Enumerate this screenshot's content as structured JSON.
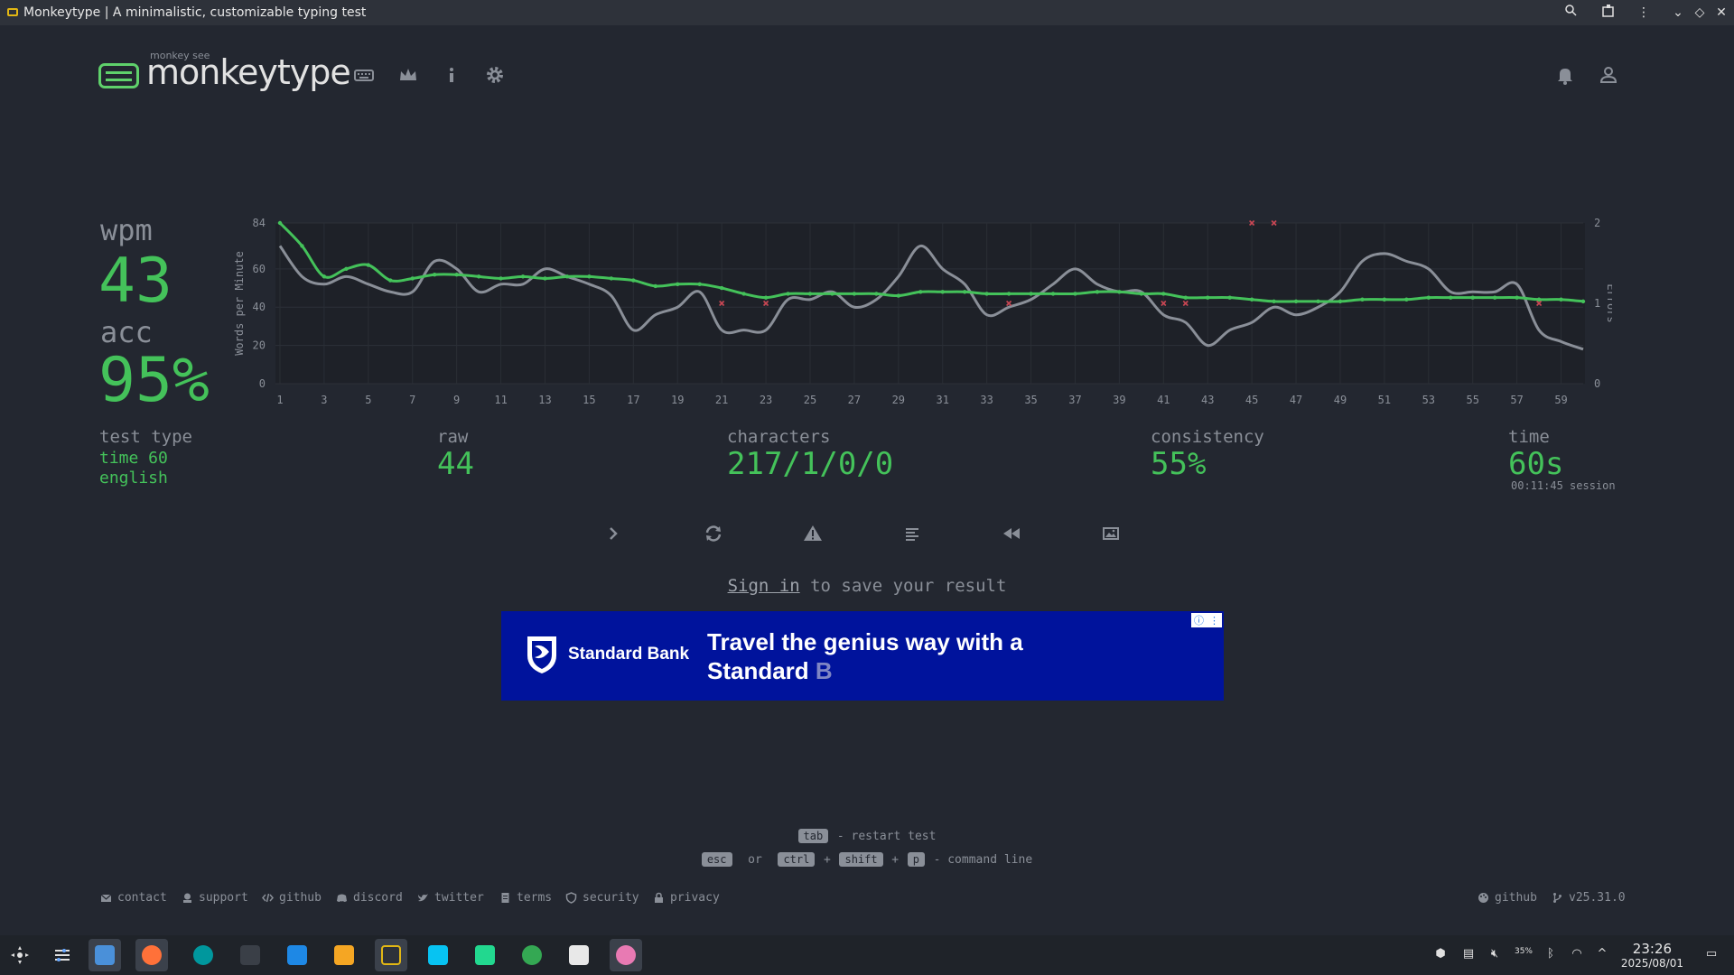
{
  "window": {
    "title": "Monkeytype | A minimalistic, customizable typing test"
  },
  "header": {
    "logo_small": "monkey see",
    "logo_text": "monkeytype",
    "nav_icons": [
      "keyboard-icon",
      "crown-icon",
      "info-icon",
      "gear-icon"
    ],
    "right_icons": [
      "bell-icon",
      "user-icon"
    ]
  },
  "stats": {
    "wpm_label": "wpm",
    "wpm_value": "43",
    "acc_label": "acc",
    "acc_value": "95%",
    "test_type_label": "test type",
    "test_type_mode": "time 60",
    "test_type_lang": "english",
    "raw_label": "raw",
    "raw_value": "44",
    "characters_label": "characters",
    "characters_value": "217/1/0/0",
    "consistency_label": "consistency",
    "consistency_value": "55%",
    "time_label": "time",
    "time_value": "60s",
    "session_value": "00:11:45 session"
  },
  "chart_data": {
    "type": "line",
    "ylabel": "Words per Minute",
    "y2label": "Errors",
    "ylim": [
      0,
      84
    ],
    "yticks": [
      0,
      20,
      40,
      60,
      84
    ],
    "y2lim": [
      0,
      2
    ],
    "y2ticks": [
      0,
      1,
      2
    ],
    "xlim": [
      1,
      60
    ],
    "xticks": [
      1,
      3,
      5,
      7,
      9,
      11,
      13,
      15,
      17,
      19,
      21,
      23,
      25,
      27,
      29,
      31,
      33,
      35,
      37,
      39,
      41,
      43,
      45,
      47,
      49,
      51,
      53,
      55,
      57,
      59
    ],
    "grid": true,
    "series": [
      {
        "name": "wpm",
        "color": "#44c25a",
        "x": [
          1,
          2,
          3,
          4,
          5,
          6,
          7,
          8,
          9,
          10,
          11,
          12,
          13,
          14,
          15,
          16,
          17,
          18,
          19,
          20,
          21,
          22,
          23,
          24,
          25,
          26,
          27,
          28,
          29,
          30,
          31,
          32,
          33,
          34,
          35,
          36,
          37,
          38,
          39,
          40,
          41,
          42,
          43,
          44,
          45,
          46,
          47,
          48,
          49,
          50,
          51,
          52,
          53,
          54,
          55,
          56,
          57,
          58,
          59,
          60
        ],
        "values": [
          84,
          72,
          56,
          60,
          62,
          54,
          55,
          57,
          57,
          56,
          55,
          56,
          55,
          56,
          56,
          55,
          54,
          51,
          52,
          52,
          50,
          47,
          45,
          47,
          47,
          47,
          47,
          47,
          46,
          48,
          48,
          48,
          47,
          47,
          47,
          47,
          47,
          48,
          48,
          47,
          47,
          45,
          45,
          45,
          44,
          43,
          43,
          43,
          43,
          44,
          44,
          44,
          45,
          45,
          45,
          45,
          45,
          44,
          44,
          43
        ]
      },
      {
        "name": "raw",
        "color": "#8a8f98",
        "x": [
          1,
          2,
          3,
          4,
          5,
          6,
          7,
          8,
          9,
          10,
          11,
          12,
          13,
          14,
          15,
          16,
          17,
          18,
          19,
          20,
          21,
          22,
          23,
          24,
          25,
          26,
          27,
          28,
          29,
          30,
          31,
          32,
          33,
          34,
          35,
          36,
          37,
          38,
          39,
          40,
          41,
          42,
          43,
          44,
          45,
          46,
          47,
          48,
          49,
          50,
          51,
          52,
          53,
          54,
          55,
          56,
          57,
          58,
          59,
          60
        ],
        "values": [
          72,
          56,
          52,
          56,
          52,
          48,
          48,
          64,
          60,
          48,
          52,
          52,
          60,
          56,
          52,
          46,
          28,
          36,
          40,
          48,
          28,
          28,
          28,
          44,
          44,
          48,
          40,
          44,
          56,
          72,
          60,
          52,
          36,
          40,
          44,
          52,
          60,
          52,
          48,
          48,
          36,
          32,
          20,
          28,
          32,
          40,
          36,
          40,
          48,
          64,
          68,
          64,
          60,
          48,
          48,
          48,
          52,
          28,
          22,
          18
        ]
      },
      {
        "name": "errors",
        "color": "#ca4754",
        "x": [
          21,
          23,
          34,
          41,
          42,
          45,
          46,
          58
        ],
        "values": [
          1,
          1,
          1,
          1,
          1,
          2,
          2,
          1
        ]
      }
    ]
  },
  "actions": [
    "chevron-right-icon",
    "refresh-icon",
    "warning-icon",
    "align-left-icon",
    "rewind-icon",
    "image-icon"
  ],
  "signin": {
    "link": "Sign in",
    "rest": " to save your result"
  },
  "ad": {
    "brand": "Standard Bank",
    "headline": "Travel the genius way with a Standard",
    "headline_tail": "B"
  },
  "shortcuts": {
    "tab_key": "tab",
    "tab_text": "- restart test",
    "esc_key": "esc",
    "or": "or",
    "ctrl_key": "ctrl",
    "plus": "+",
    "shift_key": "shift",
    "p_key": "p",
    "cmd_text": "- command line"
  },
  "footer": {
    "contact": "contact",
    "support": "support",
    "github": "github",
    "discord": "discord",
    "twitter": "twitter",
    "terms": "terms",
    "security": "security",
    "privacy": "privacy",
    "github_right": "github",
    "version": "v25.31.0"
  },
  "taskbar": {
    "time": "23:26",
    "date": "2025/08/01",
    "battery": "35%"
  },
  "colors": {
    "bg": "#232730",
    "accent": "#44c25a",
    "sub": "#8a8f98",
    "error": "#ca4754"
  }
}
